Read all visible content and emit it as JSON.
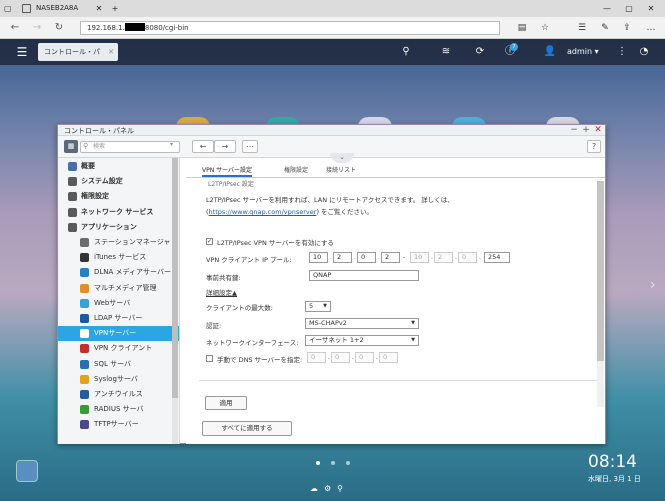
{
  "browser": {
    "tab_title": "NASEB2A8A",
    "url_prefix": "192.168.1.",
    "url_suffix": "8080/cgi-bin"
  },
  "qts": {
    "tab_label": "コントロール・パ",
    "user": "admin ▾",
    "notification_count": "7"
  },
  "window": {
    "title": "コントロール・パネル",
    "search_placeholder": "検索"
  },
  "sidebar": {
    "items": [
      {
        "label": "概要",
        "category": true,
        "color": "#4a6fa5"
      },
      {
        "label": "システム設定",
        "category": true,
        "color": "#5a5a5a"
      },
      {
        "label": "権限設定",
        "category": true,
        "color": "#5a5a5a"
      },
      {
        "label": "ネットワーク サービス",
        "category": true,
        "color": "#5a5a5a"
      },
      {
        "label": "アプリケーション",
        "category": true,
        "color": "#5a5a5a"
      },
      {
        "label": "ステーションマネージャ",
        "category": false,
        "color": "#6c6c6c"
      },
      {
        "label": "iTunes サービス",
        "category": false,
        "color": "#333333"
      },
      {
        "label": "DLNA メディアサーバー",
        "category": false,
        "color": "#2a7fc4"
      },
      {
        "label": "マルチメディア管理",
        "category": false,
        "color": "#e0902a"
      },
      {
        "label": "Webサーバ",
        "category": false,
        "color": "#3aa0d8"
      },
      {
        "label": "LDAP サーバー",
        "category": false,
        "color": "#1e5aa0"
      },
      {
        "label": "VPNサーバー",
        "category": false,
        "color": "#ffffff",
        "selected": true
      },
      {
        "label": "VPN クライアント",
        "category": false,
        "color": "#c03030"
      },
      {
        "label": "SQL サーバ",
        "category": false,
        "color": "#2a6fb0"
      },
      {
        "label": "Syslogサーバ",
        "category": false,
        "color": "#e0a020"
      },
      {
        "label": "アンチウイルス",
        "category": false,
        "color": "#2a5a9a"
      },
      {
        "label": "RADIUS サーバ",
        "category": false,
        "color": "#3a9a3a"
      },
      {
        "label": "TFTPサーバー",
        "category": false,
        "color": "#4a4a8a"
      }
    ]
  },
  "tabs": [
    "VPN サーバー設定",
    "権限設定",
    "接続リスト"
  ],
  "content": {
    "section_cut": "L2TP/IPsec 設定",
    "desc_text": "L2TP/IPsec サーバーを利用すれば、LAN にリモートアクセスできます。 詳しくは、(",
    "desc_link": "https://www.qnap.com/vpnserver",
    "desc_tail": ") をご覧ください。",
    "enable_label": "L2TP/IPsec VPN サーバーを有効にする",
    "pool_label": "VPN クライアント IP プール:",
    "ip_start": [
      "10",
      "2",
      "0",
      "2"
    ],
    "ip_end": [
      "10",
      "2",
      "0",
      "254"
    ],
    "psk_label": "事前共有鍵:",
    "psk_value": "QNAP",
    "advanced_label": "詳細設定▲",
    "max_clients_label": "クライアントの最大数:",
    "max_clients_value": "5",
    "auth_label": "認証:",
    "auth_value": "MS-CHAPv2",
    "iface_label": "ネットワークインターフェース:",
    "iface_value": "イーサネット 1+2",
    "dns_label": "手動で DNS サーバーを指定:",
    "dns_values": [
      "0",
      "0",
      "0",
      "0"
    ],
    "apply": "適用",
    "apply_all": "すべてに適用する"
  },
  "desktop": {
    "time": "08:14",
    "date": "水曜日, 3月 1 日"
  }
}
